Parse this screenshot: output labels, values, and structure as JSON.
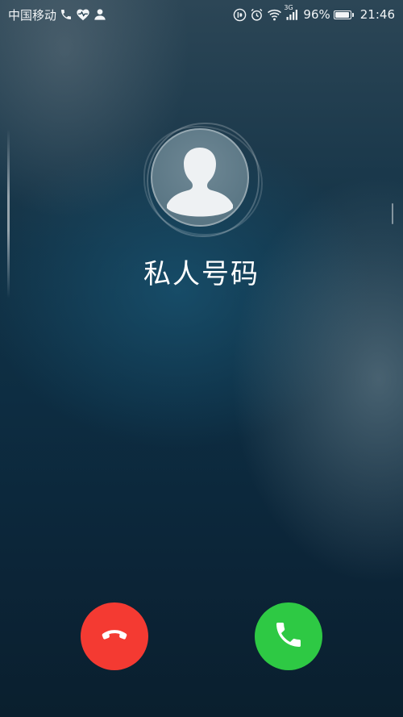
{
  "status_bar": {
    "carrier": "中国移动",
    "network": "3G",
    "battery_percent": "96%",
    "battery_level": 0.96,
    "time": "21:46",
    "left_icons": [
      "phone-call-icon",
      "heart-rate-icon",
      "person-icon"
    ],
    "right_icons": [
      "hd-call-icon",
      "alarm-icon",
      "wifi-icon",
      "signal-icon",
      "battery-icon"
    ]
  },
  "call": {
    "caller_name": "私人号码",
    "avatar_icon": "default-avatar-icon",
    "decline_icon": "hang-up-icon",
    "answer_icon": "phone-answer-icon"
  },
  "colors": {
    "decline": "#f43a32",
    "answer": "#2ec944"
  }
}
